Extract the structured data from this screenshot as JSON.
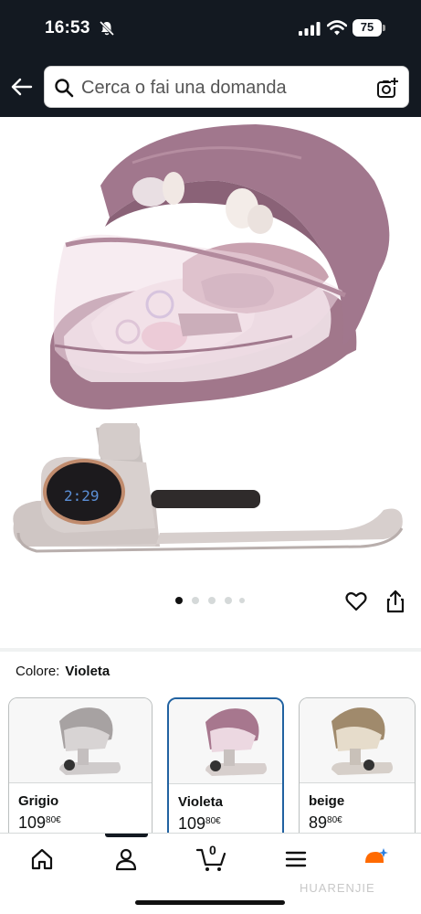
{
  "status_bar": {
    "time": "16:53",
    "battery": "75"
  },
  "header": {
    "search_placeholder": "Cerca o fai una domanda"
  },
  "carousel": {
    "total_images": 5,
    "active_index": 0
  },
  "colors": {
    "dark_header": "#131921",
    "selected_border": "#2162a1",
    "product_pink": "#9a6f83",
    "cart_badge": "#ff9900"
  },
  "variant_selector": {
    "label": "Colore:",
    "selected": "Violeta",
    "options": [
      {
        "name": "Grigio",
        "price_whole": "109",
        "price_fraction": "80",
        "currency": "€",
        "tint": "#9a9595"
      },
      {
        "name": "Violeta",
        "price_whole": "109",
        "price_fraction": "80",
        "currency": "€",
        "tint": "#a7778e"
      },
      {
        "name": "beige",
        "price_whole": "89",
        "price_fraction": "80",
        "currency": "€",
        "tint": "#a08a6c"
      }
    ]
  },
  "bottom_nav": {
    "cart_count": "0",
    "items": [
      "home-icon",
      "account-icon",
      "cart-icon",
      "menu-icon",
      "ai-assistant-icon"
    ]
  },
  "watermark": "HUARENJIE"
}
